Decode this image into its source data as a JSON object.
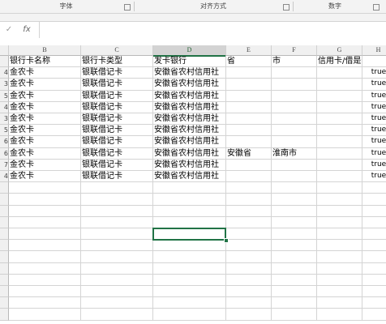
{
  "ribbon": {
    "groups": [
      {
        "label": "字体"
      },
      {
        "label": "对齐方式"
      },
      {
        "label": "数字"
      }
    ]
  },
  "formula_bar": {
    "confirm_glyph": "✓",
    "fx_label": "fx",
    "value": ""
  },
  "columns": [
    "B",
    "C",
    "D",
    "E",
    "F",
    "G",
    "H"
  ],
  "row_numbers": [
    "",
    "4",
    "3",
    "5",
    "4",
    "3",
    "5",
    "6",
    "6",
    "7",
    "4"
  ],
  "rows": [
    [
      "银行卡名称",
      "银行卡类型",
      "发卡银行",
      "省",
      "市",
      "信用卡/借是否符",
      ""
    ],
    [
      "金农卡",
      "银联借记卡",
      "安徽省农村信用社",
      "",
      "",
      "",
      "true"
    ],
    [
      "金农卡",
      "银联借记卡",
      "安徽省农村信用社",
      "",
      "",
      "",
      "true"
    ],
    [
      "金农卡",
      "银联借记卡",
      "安徽省农村信用社",
      "",
      "",
      "",
      "true"
    ],
    [
      "金农卡",
      "银联借记卡",
      "安徽省农村信用社",
      "",
      "",
      "",
      "true"
    ],
    [
      "金农卡",
      "银联借记卡",
      "安徽省农村信用社",
      "",
      "",
      "",
      "true"
    ],
    [
      "金农卡",
      "银联借记卡",
      "安徽省农村信用社",
      "",
      "",
      "",
      "true"
    ],
    [
      "金农卡",
      "银联借记卡",
      "安徽省农村信用社",
      "",
      "",
      "",
      "true"
    ],
    [
      "金农卡",
      "银联借记卡",
      "安徽省农村信用社",
      "安徽省",
      "淮南市",
      "",
      "true"
    ],
    [
      "金农卡",
      "银联借记卡",
      "安徽省农村信用社",
      "",
      "",
      "",
      "true"
    ],
    [
      "金农卡",
      "银联借记卡",
      "安徽省农村信用社",
      "",
      "",
      "",
      "true"
    ]
  ],
  "selected_column": "D",
  "accent_color": "#217346"
}
